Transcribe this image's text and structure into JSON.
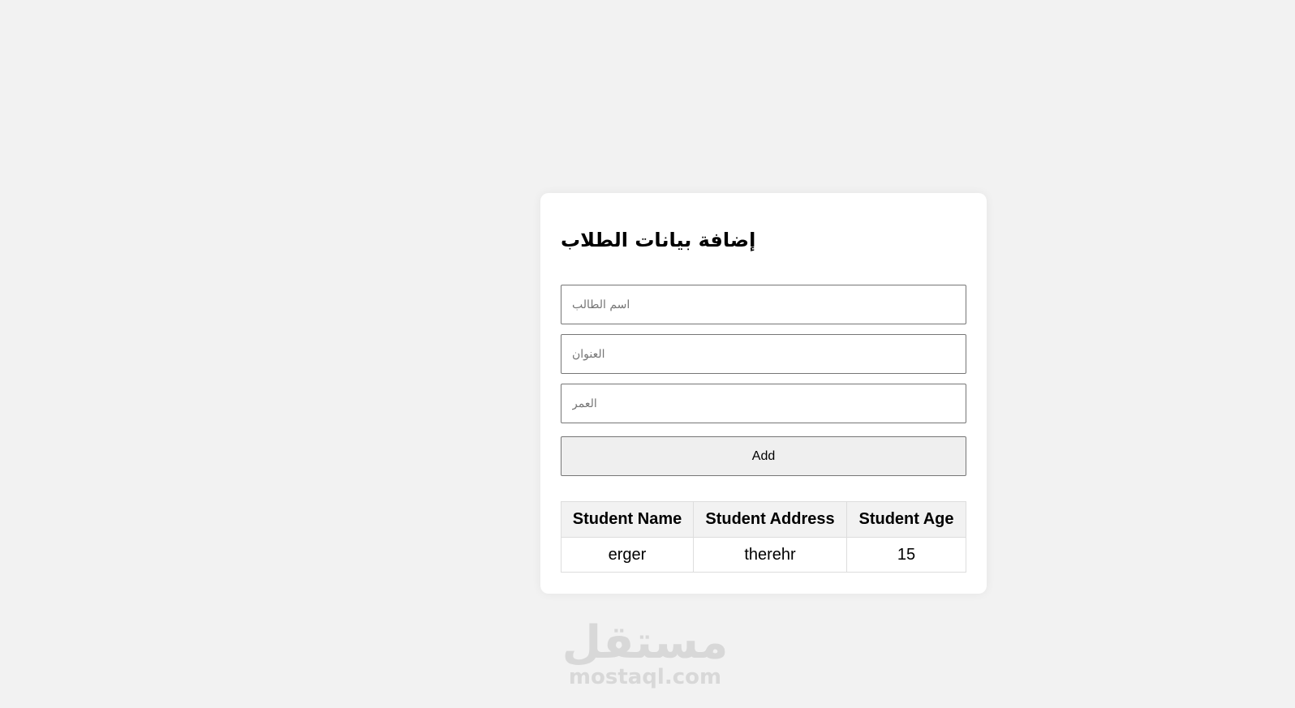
{
  "form": {
    "title": "إضافة بيانات الطلاب",
    "name_field": {
      "placeholder": "اسم الطالب",
      "value": ""
    },
    "address_field": {
      "placeholder": "العنوان",
      "value": ""
    },
    "age_field": {
      "placeholder": "العمر",
      "value": ""
    },
    "add_label": "Add"
  },
  "table": {
    "headers": [
      "Student Name",
      "Student Address",
      "Student Age"
    ],
    "rows": [
      [
        "erger",
        "therehr",
        "15"
      ]
    ]
  },
  "watermark": {
    "arabic": "مستقل",
    "latin": "mostaql.com"
  },
  "colors": {
    "page_background": "#f2f2f2",
    "card_background": "#ffffff",
    "button_background": "#efefef",
    "header_background": "#f2f2f2"
  }
}
